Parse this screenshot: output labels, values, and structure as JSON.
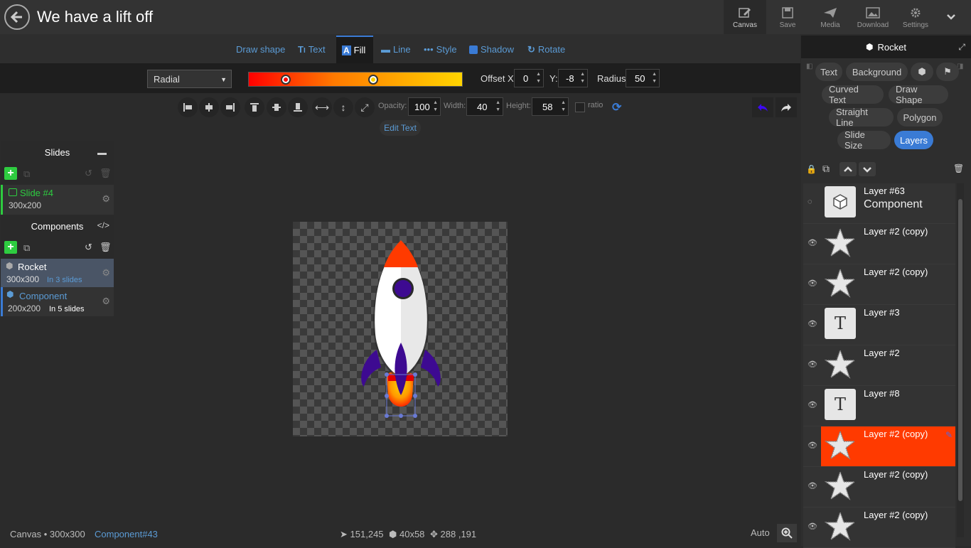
{
  "header": {
    "title": "We have a lift off",
    "buttons": [
      {
        "label": "Canvas",
        "icon": "edit-icon"
      },
      {
        "label": "Save",
        "icon": "save-icon"
      },
      {
        "label": "Media",
        "icon": "send-icon"
      },
      {
        "label": "Download",
        "icon": "image-icon"
      },
      {
        "label": "Settings",
        "icon": "gear-icon"
      }
    ]
  },
  "tabs": [
    "Draw shape",
    "Text",
    "Fill",
    "Line",
    "Style",
    "Shadow",
    "Rotate"
  ],
  "active_tab": "Fill",
  "fill": {
    "type": "Radial",
    "offset_x_label": "Offset X:",
    "offset_x": "0",
    "y_label": "Y:",
    "y": "-8",
    "radius_label": "Radius:",
    "radius": "50",
    "stop_colors": [
      "#ff0000",
      "#ffd400"
    ]
  },
  "tools": {
    "opacity_label": "Opacity:",
    "opacity": "100",
    "width_label": "Width:",
    "width": "40",
    "height_label": "Height:",
    "height": "58",
    "ratio_label": "ratio",
    "edit_text": "Edit Text"
  },
  "slides": {
    "title": "Slides",
    "items": [
      {
        "name": "Slide #4",
        "size": "300x200"
      }
    ]
  },
  "components": {
    "title": "Components",
    "items": [
      {
        "name": "Rocket",
        "size": "300x300",
        "usage": "In 3 slides"
      },
      {
        "name": "Component",
        "size": "200x200",
        "usage": "In 5 slides"
      }
    ]
  },
  "right_panel": {
    "title": "Rocket",
    "pills": [
      [
        "Text",
        "Background"
      ],
      [
        "Curved Text",
        "Draw Shape"
      ],
      [
        "Straight Line",
        "Polygon"
      ],
      [
        "Slide Size",
        "Layers"
      ]
    ],
    "active_pill": "Layers",
    "layers": [
      {
        "name": "Layer #63",
        "sub": "Component",
        "thumb": "cube"
      },
      {
        "name": "Layer #2 (copy)",
        "thumb": "star"
      },
      {
        "name": "Layer #2 (copy)",
        "thumb": "star"
      },
      {
        "name": "Layer #3",
        "thumb": "T"
      },
      {
        "name": "Layer #2",
        "thumb": "star"
      },
      {
        "name": "Layer #8",
        "thumb": "T"
      },
      {
        "name": "Layer #2 (copy)",
        "thumb": "star",
        "selected": true
      },
      {
        "name": "Layer #2 (copy)",
        "thumb": "star"
      },
      {
        "name": "Layer #2 (copy)",
        "thumb": "star"
      }
    ]
  },
  "status": {
    "canvas": "Canvas • 300x300",
    "component": "Component#43",
    "position": "151,245",
    "size": "40x58",
    "anchor": "288 ,191",
    "zoom": "Auto"
  },
  "colors": {
    "accent": "#3a7bd5",
    "selected_layer": "#ff3a00",
    "green": "#2ecc40",
    "rocket_nose": "#ff3a00",
    "rocket_purple": "#3d0a91"
  }
}
